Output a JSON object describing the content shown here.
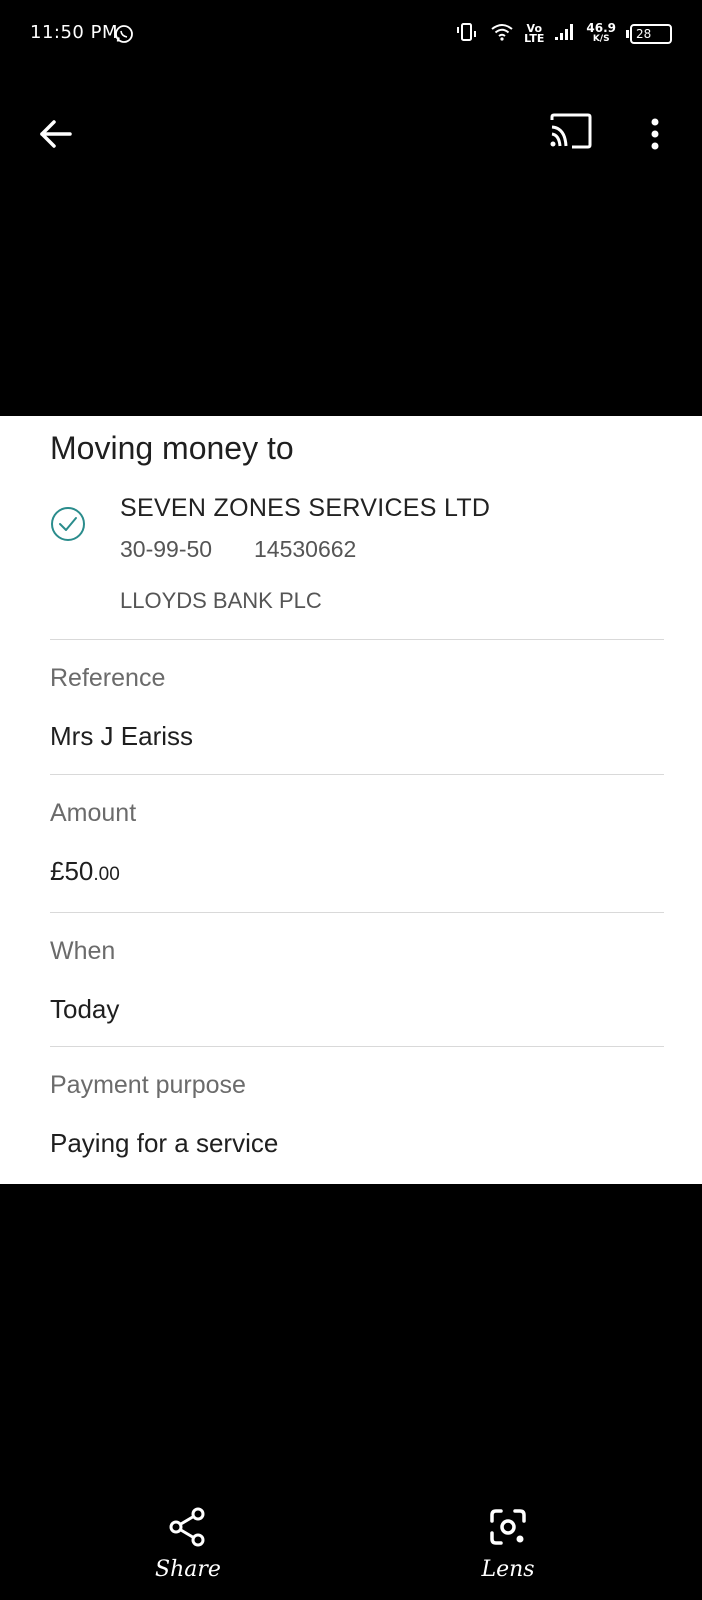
{
  "status_bar": {
    "time": "11:50 PM",
    "volte_top": "Vo",
    "volte_bottom": "LTE",
    "net_speed": "46.9",
    "net_unit": "K/S",
    "battery": "28"
  },
  "icons": {
    "back": "arrow-left-icon",
    "cast": "cast-icon",
    "more": "more-vert-icon",
    "verified": "check-circle-icon",
    "share": "share-icon",
    "lens": "lens-icon"
  },
  "payment": {
    "title": "Moving money to",
    "payee_name": "SEVEN ZONES SERVICES LTD",
    "sort_code": "30-99-50",
    "account_number": "14530662",
    "bank": "LLOYDS BANK PLC",
    "reference_label": "Reference",
    "reference_value": "Mrs J Eariss",
    "amount_label": "Amount",
    "amount_main": "£50",
    "amount_cents": ".00",
    "when_label": "When",
    "when_value": "Today",
    "purpose_label": "Payment purpose",
    "purpose_value": "Paying for a service"
  },
  "bottom_bar": {
    "share_label": "Share",
    "lens_label": "Lens"
  },
  "colors": {
    "accent_teal": "#2a8c8c",
    "background": "#000000",
    "card": "#ffffff"
  }
}
